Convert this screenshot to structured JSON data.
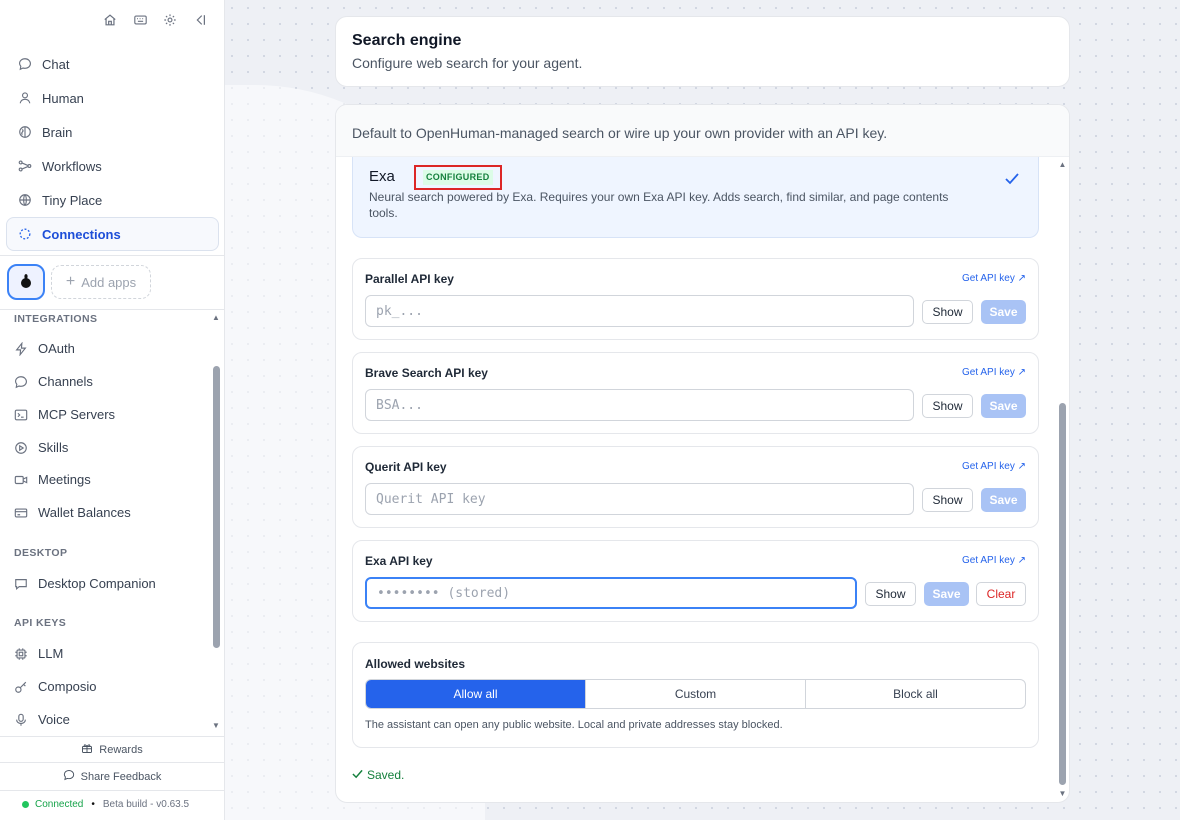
{
  "sidebar": {
    "top_icons": [
      "home-icon",
      "keyboard-icon",
      "gear-icon",
      "collapse-sidebar-icon"
    ],
    "nav": [
      {
        "label": "Chat",
        "icon": "chat-icon"
      },
      {
        "label": "Human",
        "icon": "user-icon"
      },
      {
        "label": "Brain",
        "icon": "brain-icon"
      },
      {
        "label": "Workflows",
        "icon": "workflow-icon"
      },
      {
        "label": "Tiny Place",
        "icon": "globe-icon"
      },
      {
        "label": "Connections",
        "icon": "connections-icon",
        "active": true
      }
    ],
    "add_apps_label": "Add apps",
    "sections": {
      "integrations_title": "INTEGRATIONS",
      "integrations": [
        "OAuth",
        "Channels",
        "MCP Servers",
        "Skills",
        "Meetings",
        "Wallet Balances"
      ],
      "desktop_title": "DESKTOP",
      "desktop": [
        "Desktop Companion"
      ],
      "api_keys_title": "API KEYS",
      "api_keys": [
        "LLM",
        "Composio",
        "Voice"
      ]
    },
    "rewards_label": "Rewards",
    "feedback_label": "Share Feedback",
    "status": {
      "connected": "Connected",
      "separator": "•",
      "build": "Beta build - v0.63.5",
      "color": "#22c55e"
    }
  },
  "header": {
    "title": "Search engine",
    "subtitle": "Configure web search for your agent."
  },
  "main": {
    "intro": "Default to OpenHuman-managed search or wire up your own provider with an API key.",
    "exa_option": {
      "name": "Exa",
      "badge": "CONFIGURED",
      "description": "Neural search powered by Exa. Requires your own Exa API key. Adds search, find similar, and page contents tools."
    },
    "keys": [
      {
        "label": "Parallel API key",
        "link": "Get API key ↗",
        "placeholder": "pk_...",
        "show": "Show",
        "save": "Save"
      },
      {
        "label": "Brave Search API key",
        "link": "Get API key ↗",
        "placeholder": "BSA...",
        "show": "Show",
        "save": "Save"
      },
      {
        "label": "Querit API key",
        "link": "Get API key ↗",
        "placeholder": "Querit API key",
        "show": "Show",
        "save": "Save"
      },
      {
        "label": "Exa API key",
        "link": "Get API key ↗",
        "placeholder": "•••••••• (stored)",
        "show": "Show",
        "save": "Save",
        "clear": "Clear"
      }
    ],
    "allowed": {
      "title": "Allowed websites",
      "options": [
        "Allow all",
        "Custom",
        "Block all"
      ],
      "selected": "Allow all",
      "note": "The assistant can open any public website. Local and private addresses stay blocked."
    },
    "saved_text": "Saved."
  },
  "colors": {
    "accent": "#2563eb",
    "success": "#15803d",
    "danger": "#dc2626"
  }
}
